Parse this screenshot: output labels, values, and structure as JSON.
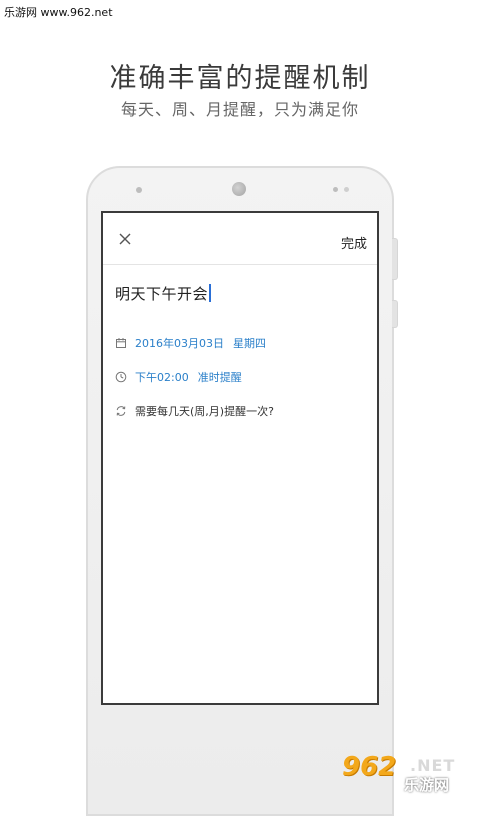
{
  "watermark_top": "乐游网 www.962.net",
  "headline": "准确丰富的提醒机制",
  "subline": "每天、周、月提醒，只为满足你",
  "screen": {
    "done_label": "完成",
    "title_value": "明天下午开会",
    "date": "2016年03月03日",
    "weekday": "星期四",
    "time": "下午02:00",
    "time_mode": "准时提醒",
    "repeat_prompt": "需要每几天(周,月)提醒一次?"
  },
  "icons": {
    "close": "close-icon",
    "calendar": "calendar-icon",
    "clock": "clock-icon",
    "repeat": "repeat-icon"
  },
  "colors": {
    "accent": "#2a7fc9",
    "caret": "#2a6fd6",
    "watermark_orange": "#f3a81b"
  },
  "watermark_bottom": {
    "number": "962",
    "net": ".NET",
    "cn": "乐游网"
  }
}
